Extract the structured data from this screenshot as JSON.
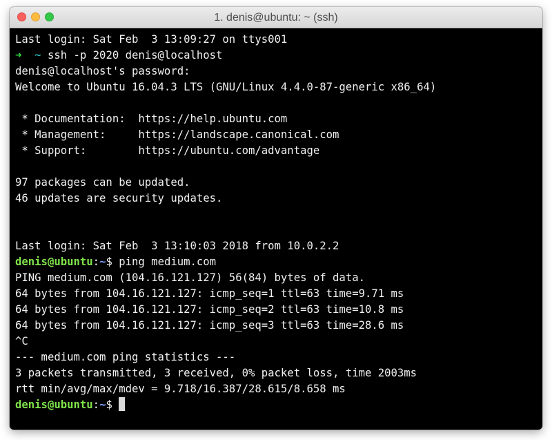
{
  "window": {
    "title": "1. denis@ubuntu: ~ (ssh)"
  },
  "colors": {
    "arrow": "#28e03a",
    "tilde": "#33d9d9",
    "userhost": "#7fe24a",
    "cwd": "#7a9cff",
    "background": "#000000",
    "text": "#f0f0f0"
  },
  "terminal": {
    "lines": [
      "Last login: Sat Feb  3 13:09:27 on ttys001",
      {
        "arrow": "➜",
        "tilde": "~",
        "command": "ssh -p 2020 denis@localhost"
      },
      "denis@localhost's password:",
      "Welcome to Ubuntu 16.04.3 LTS (GNU/Linux 4.4.0-87-generic x86_64)",
      "",
      " * Documentation:  https://help.ubuntu.com",
      " * Management:     https://landscape.canonical.com",
      " * Support:        https://ubuntu.com/advantage",
      "",
      "97 packages can be updated.",
      "46 updates are security updates.",
      "",
      "",
      "Last login: Sat Feb  3 13:10:03 2018 from 10.0.2.2",
      {
        "userhost": "denis@ubuntu",
        "sep": ":",
        "cwd": "~",
        "dollar": "$",
        "command": "ping medium.com"
      },
      "PING medium.com (104.16.121.127) 56(84) bytes of data.",
      "64 bytes from 104.16.121.127: icmp_seq=1 ttl=63 time=9.71 ms",
      "64 bytes from 104.16.121.127: icmp_seq=2 ttl=63 time=10.8 ms",
      "64 bytes from 104.16.121.127: icmp_seq=3 ttl=63 time=28.6 ms",
      "^C",
      "--- medium.com ping statistics ---",
      "3 packets transmitted, 3 received, 0% packet loss, time 2003ms",
      "rtt min/avg/max/mdev = 9.718/16.387/28.615/8.658 ms",
      {
        "userhost": "denis@ubuntu",
        "sep": ":",
        "cwd": "~",
        "dollar": "$",
        "command": "",
        "cursor": true
      }
    ]
  }
}
